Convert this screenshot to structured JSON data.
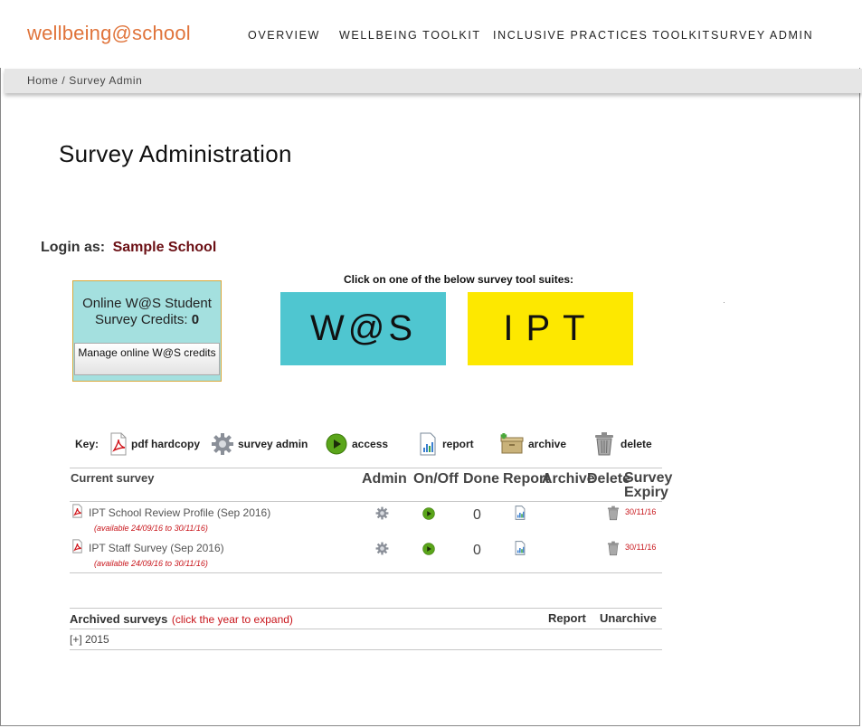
{
  "header": {
    "logo": "wellbeing@school",
    "nav": [
      "OVERVIEW",
      "WELLBEING TOOLKIT",
      "INCLUSIVE PRACTICES TOOLKIT",
      "SURVEY ADMIN"
    ]
  },
  "breadcrumb": "Home / Survey Admin",
  "page_title": "Survey Administration",
  "login": {
    "label": "Login as:",
    "school": "Sample School"
  },
  "credits": {
    "text": "Online W@S Student Survey Credits:",
    "count": "0",
    "manage_button": "Manage online W@S credits"
  },
  "suites": {
    "instruction": "Click on one of the below survey tool suites:",
    "was": "W@S",
    "ipt": "IPT"
  },
  "key": {
    "label": "Key:",
    "items": [
      {
        "icon": "pdf-icon",
        "label": "pdf hardcopy"
      },
      {
        "icon": "gear-icon",
        "label": "survey admin"
      },
      {
        "icon": "play-icon",
        "label": "access"
      },
      {
        "icon": "report-icon",
        "label": "report"
      },
      {
        "icon": "archive-icon",
        "label": "archive"
      },
      {
        "icon": "trash-icon",
        "label": "delete"
      }
    ]
  },
  "current": {
    "headers": {
      "survey": "Current survey",
      "admin": "Admin",
      "onoff": "On/Off",
      "done": "Done",
      "report": "Report",
      "archive": "Archive",
      "delete": "Delete",
      "expiry": "Survey Expiry"
    },
    "rows": [
      {
        "name": "IPT School Review Profile (Sep 2016)",
        "available": "(available 24/09/16 to 30/11/16)",
        "done": "0",
        "expiry": "30/11/16"
      },
      {
        "name": "IPT Staff Survey (Sep 2016)",
        "available": "(available 24/09/16 to 30/11/16)",
        "done": "0",
        "expiry": "30/11/16"
      }
    ]
  },
  "archived": {
    "title": "Archived surveys",
    "hint": "(click the year to expand)",
    "report": "Report",
    "unarchive": "Unarchive",
    "years": [
      "[+] 2015"
    ]
  }
}
